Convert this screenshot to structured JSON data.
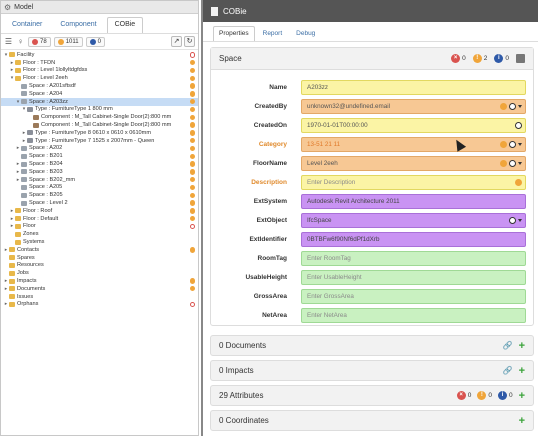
{
  "left": {
    "title": "Model",
    "tabs": [
      {
        "label": "Container",
        "active": false
      },
      {
        "label": "Component",
        "active": false
      },
      {
        "label": "COBie",
        "active": true
      }
    ],
    "filters": {
      "errors": "78",
      "warnings": "1011",
      "info": "0"
    },
    "tree": [
      {
        "label": "Facility",
        "depth": 0,
        "toggle": "▾",
        "icon": "folder",
        "status": "err"
      },
      {
        "label": "Floor : TFDN",
        "depth": 1,
        "toggle": "▸",
        "icon": "folder",
        "status": "warn"
      },
      {
        "label": "Floor : Level 1lollyltdgfdss",
        "depth": 1,
        "toggle": "▸",
        "icon": "folder",
        "status": "warn"
      },
      {
        "label": "Floor : Level 2eeh",
        "depth": 1,
        "toggle": "▾",
        "icon": "folder",
        "status": "warn"
      },
      {
        "label": "Space : A201sftsdf",
        "depth": 2,
        "toggle": "",
        "icon": "space",
        "status": "warn"
      },
      {
        "label": "Space : A204",
        "depth": 2,
        "toggle": "",
        "icon": "space",
        "status": "warn"
      },
      {
        "label": "Space : A203zz",
        "depth": 2,
        "toggle": "▾",
        "icon": "space",
        "status": "warn",
        "selected": true
      },
      {
        "label": "Type : FurnitureType 1 800 mm",
        "depth": 3,
        "toggle": "▾",
        "icon": "type",
        "status": "warn"
      },
      {
        "label": "Component : M_Tall Cabinet-Single Door(2):800 mm",
        "depth": 4,
        "toggle": "",
        "icon": "comp",
        "status": "warn"
      },
      {
        "label": "Component : M_Tall Cabinet-Single Door(2):800 mm",
        "depth": 4,
        "toggle": "",
        "icon": "comp",
        "status": "warn"
      },
      {
        "label": "Type : FurnitureType 8 0610 x 0610 x 0610mm",
        "depth": 3,
        "toggle": "▸",
        "icon": "type",
        "status": "warn"
      },
      {
        "label": "Type : FurnitureType 7 1525 x 2007mm - Queen",
        "depth": 3,
        "toggle": "▸",
        "icon": "type",
        "status": "warn"
      },
      {
        "label": "Space : A202",
        "depth": 2,
        "toggle": "▸",
        "icon": "space",
        "status": "warn"
      },
      {
        "label": "Space : B201",
        "depth": 2,
        "toggle": "",
        "icon": "space",
        "status": "warn"
      },
      {
        "label": "Space : B204",
        "depth": 2,
        "toggle": "▸",
        "icon": "space",
        "status": "warn"
      },
      {
        "label": "Space : B203",
        "depth": 2,
        "toggle": "▸",
        "icon": "space",
        "status": "warn"
      },
      {
        "label": "Space : B202_mm",
        "depth": 2,
        "toggle": "▸",
        "icon": "space",
        "status": "warn"
      },
      {
        "label": "Space : A205",
        "depth": 2,
        "toggle": "",
        "icon": "space",
        "status": "warn"
      },
      {
        "label": "Space : B205",
        "depth": 2,
        "toggle": "",
        "icon": "space",
        "status": "warn"
      },
      {
        "label": "Space : Level 2",
        "depth": 2,
        "toggle": "",
        "icon": "space",
        "status": "warn"
      },
      {
        "label": "Floor : Roof",
        "depth": 1,
        "toggle": "▸",
        "icon": "folder",
        "status": "warn"
      },
      {
        "label": "Floor : Default",
        "depth": 1,
        "toggle": "▸",
        "icon": "folder",
        "status": "warn"
      },
      {
        "label": "Floor",
        "depth": 1,
        "toggle": "▸",
        "icon": "folder",
        "status": "err"
      },
      {
        "label": "Zones",
        "depth": 1,
        "toggle": "",
        "icon": "folder",
        "status": ""
      },
      {
        "label": "Systems",
        "depth": 1,
        "toggle": "",
        "icon": "folder",
        "status": ""
      },
      {
        "label": "Contacts",
        "depth": 0,
        "toggle": "▸",
        "icon": "folder",
        "status": "warn"
      },
      {
        "label": "Spares",
        "depth": 0,
        "toggle": "",
        "icon": "folder",
        "status": ""
      },
      {
        "label": "Resources",
        "depth": 0,
        "toggle": "",
        "icon": "folder",
        "status": ""
      },
      {
        "label": "Jobs",
        "depth": 0,
        "toggle": "",
        "icon": "folder",
        "status": ""
      },
      {
        "label": "Impacts",
        "depth": 0,
        "toggle": "▸",
        "icon": "folder",
        "status": "warn"
      },
      {
        "label": "Documents",
        "depth": 0,
        "toggle": "▸",
        "icon": "folder",
        "status": "warn"
      },
      {
        "label": "Issues",
        "depth": 0,
        "toggle": "",
        "icon": "folder",
        "status": ""
      },
      {
        "label": "Orphans",
        "depth": 0,
        "toggle": "▸",
        "icon": "folder",
        "status": "err"
      }
    ]
  },
  "right": {
    "title": "COBie",
    "tabs": [
      {
        "label": "Properties",
        "active": true
      },
      {
        "label": "Report",
        "active": false
      },
      {
        "label": "Debug",
        "active": false
      }
    ],
    "space": {
      "heading": "Space",
      "counts": {
        "errors": "0",
        "warnings": "2",
        "info": "0"
      },
      "fields": [
        {
          "label": "Name",
          "value": "A203zz",
          "placeholder": false,
          "color": "yellow",
          "icons": ""
        },
        {
          "label": "CreatedBy",
          "value": "unknown32@undefined.email",
          "placeholder": false,
          "color": "orange",
          "icons": "dd"
        },
        {
          "label": "CreatedOn",
          "value": "1970-01-01T00:00:00",
          "placeholder": false,
          "color": "yellow",
          "icons": "dd-only"
        },
        {
          "label": "Category",
          "value": "13-51 21 11",
          "placeholder": false,
          "color": "orange",
          "icons": "dd",
          "warnLabel": true,
          "orangeText": true
        },
        {
          "label": "FloorName",
          "value": "Level 2eeh",
          "placeholder": false,
          "color": "orange",
          "icons": "dd"
        },
        {
          "label": "Description",
          "value": "Enter Description",
          "placeholder": true,
          "color": "yellow",
          "icons": "warn",
          "warnLabel": true
        },
        {
          "label": "ExtSystem",
          "value": "Autodesk Revit Architecture 2011",
          "placeholder": false,
          "color": "purple",
          "icons": ""
        },
        {
          "label": "ExtObject",
          "value": "IfcSpace",
          "placeholder": false,
          "color": "purple",
          "icons": "dd-noinfo"
        },
        {
          "label": "ExtIdentifier",
          "value": "0BTBFw6f90Nf6dPf1dXrb",
          "placeholder": false,
          "color": "purple",
          "icons": ""
        },
        {
          "label": "RoomTag",
          "value": "Enter RoomTag",
          "placeholder": true,
          "color": "green",
          "icons": ""
        },
        {
          "label": "UsableHeight",
          "value": "Enter UsableHeight",
          "placeholder": true,
          "color": "green",
          "icons": ""
        },
        {
          "label": "GrossArea",
          "value": "Enter GrossArea",
          "placeholder": true,
          "color": "green",
          "icons": ""
        },
        {
          "label": "NetArea",
          "value": "Enter NetArea",
          "placeholder": true,
          "color": "green",
          "icons": ""
        }
      ]
    },
    "sections": [
      {
        "label": "0 Documents",
        "link": true
      },
      {
        "label": "0 Impacts",
        "link": true
      },
      {
        "label": "29 Attributes",
        "badges": {
          "errors": "0",
          "warnings": "0",
          "info": "0"
        }
      },
      {
        "label": "0 Coordinates",
        "link": false
      }
    ]
  },
  "colors": {
    "error": "#d9534f",
    "warning": "#f0a53a",
    "info": "#2f5aa8",
    "add": "#3aa33a",
    "yellow_field": "#fbf4a5",
    "orange_field": "#f7c894",
    "purple_field": "#c993f3",
    "green_field": "#c9f1c1"
  }
}
